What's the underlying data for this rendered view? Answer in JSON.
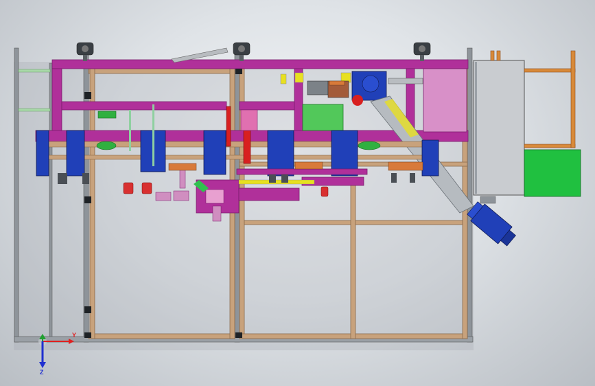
{
  "viewport": {
    "background_center": "#f4f6f8",
    "background_edge": "#b9bec4"
  },
  "colors": {
    "frame_tan": "#c8a27c",
    "frame_edge": "#8a6a4a",
    "purple_beam": "#b0309a",
    "purple_dark": "#7a1c6c",
    "blue_motor": "#2040b8",
    "green_block": "#52c85a",
    "pink_panel": "#d890c8",
    "cabinet_grey": "#c9ccd0",
    "post_grey": "#8e949a",
    "yellow_part": "#e8e020",
    "red_part": "#d82020",
    "orange_frame": "#d88a3a"
  },
  "triad": {
    "x_label": "X",
    "y_label": "Y",
    "z_label": "Z",
    "x_color": "#e02020",
    "y_color": "#20a030",
    "z_color": "#2030d0"
  }
}
